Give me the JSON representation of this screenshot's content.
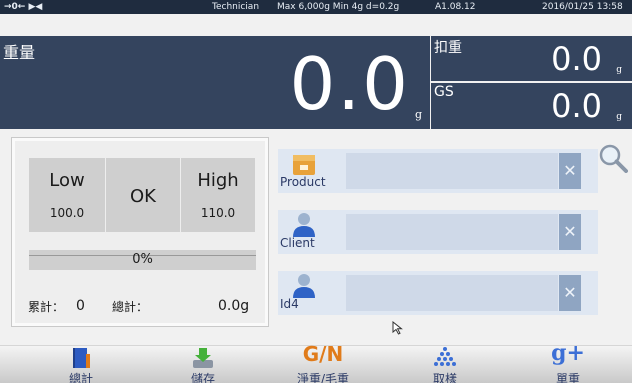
{
  "status_bar": {
    "zero_indicator": "→0← ▶◀",
    "user_role": "Technician",
    "scale_spec": "Max 6,000g  Min 4g  d=0.2g",
    "firmware": "A1.08.12",
    "datetime": "2016/01/25  13:58"
  },
  "weight": {
    "label": "重量",
    "value": "0.0",
    "unit": "g"
  },
  "tare": {
    "label": "扣重",
    "value": "0.0",
    "unit": "g"
  },
  "gross": {
    "label": "GS",
    "value": "0.0",
    "unit": "g"
  },
  "limits": {
    "low": {
      "label": "Low",
      "value": "100.0"
    },
    "status": "OK",
    "high": {
      "label": "High",
      "value": "110.0"
    },
    "progress_text": "0%",
    "progress": 0
  },
  "totals": {
    "accumulate_label": "累計：",
    "accumulate_count": "0",
    "total_label": "總計：",
    "total_value": "0.0g"
  },
  "ids": [
    {
      "label": "Product",
      "value": "",
      "icon": "product-box-icon"
    },
    {
      "label": "Client",
      "value": "",
      "icon": "person-icon"
    },
    {
      "label": "Id4",
      "value": "",
      "icon": "person-icon"
    }
  ],
  "clear_symbol": "✕",
  "toolbar": {
    "total": "總計",
    "save": "儲存",
    "net_gross_glyph": "G/N",
    "net_gross": "淨重/毛重",
    "sample": "取樣",
    "single_glyph": "g+",
    "single": "單重"
  },
  "colors": {
    "panel": "#34445e",
    "statusbar": "#1f2c3f",
    "id_row": "#dfe7f2",
    "accent_orange": "#e07b1a",
    "accent_blue": "#3c6fd6"
  }
}
